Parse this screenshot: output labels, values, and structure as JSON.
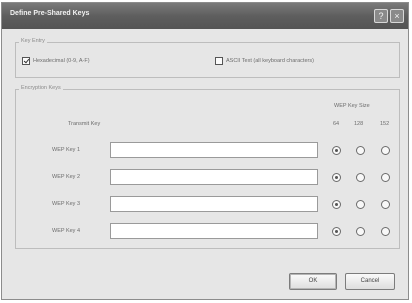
{
  "dialog": {
    "title": "Define Pre-Shared Keys",
    "help_glyph": "?",
    "close_glyph": "×"
  },
  "key_entry": {
    "legend": "Key Entry",
    "hex_label": "Hexadecimal (0-9, A-F)",
    "hex_checked": true,
    "ascii_label": "ASCII Text (all keyboard characters)",
    "ascii_checked": false
  },
  "encryption_keys": {
    "legend": "Encryption Keys",
    "transmit_key_header": "Transmit Key",
    "wep_key_size_header": "WEP Key Size",
    "size_columns": [
      "64",
      "128",
      "152"
    ],
    "rows": [
      {
        "label": "WEP Key 1",
        "value": "",
        "selected_size": "64"
      },
      {
        "label": "WEP Key 2",
        "value": "",
        "selected_size": "64"
      },
      {
        "label": "WEP Key 3",
        "value": "",
        "selected_size": "64"
      },
      {
        "label": "WEP Key 4",
        "value": "",
        "selected_size": "64"
      }
    ]
  },
  "buttons": {
    "ok": "OK",
    "cancel": "Cancel"
  }
}
